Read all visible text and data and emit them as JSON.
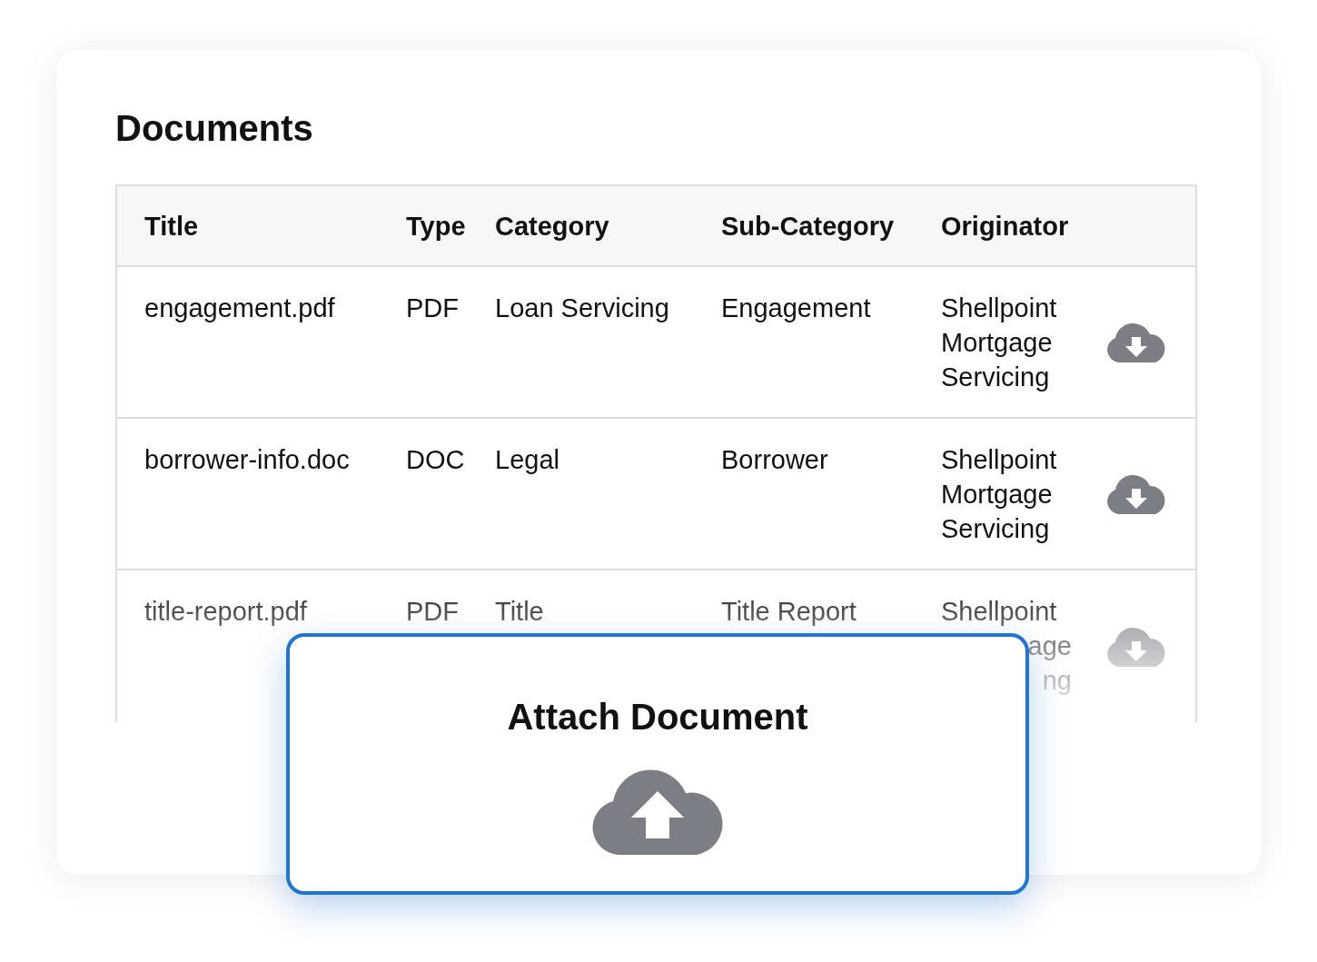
{
  "card": {
    "title": "Documents"
  },
  "table": {
    "columns": [
      "Title",
      "Type",
      "Category",
      "Sub-Category",
      "Originator"
    ],
    "rows": [
      {
        "cells": [
          "engagement.pdf",
          "PDF",
          "Loan Servicing",
          "Engagement"
        ],
        "originator": [
          {
            "text": "Shellpoint",
            "partial": false
          },
          {
            "text": "Mortgage",
            "partial": false
          },
          {
            "text": "Servicing",
            "partial": false
          }
        ]
      },
      {
        "cells": [
          "borrower-info.doc",
          "DOC",
          "Legal",
          "Borrower"
        ],
        "originator": [
          {
            "text": "Shellpoint",
            "partial": false
          },
          {
            "text": "Mortgage",
            "partial": false
          },
          {
            "text": "Servicing",
            "partial": false
          }
        ]
      },
      {
        "cells": [
          "title-report.pdf",
          "PDF",
          "Title",
          "Title Report"
        ],
        "originator": [
          {
            "text": "Shellpoint",
            "partial": false
          },
          {
            "text": "age",
            "partial": true
          },
          {
            "text": "ng",
            "partial": true
          }
        ]
      }
    ]
  },
  "dialog": {
    "title": "Attach Document"
  }
}
